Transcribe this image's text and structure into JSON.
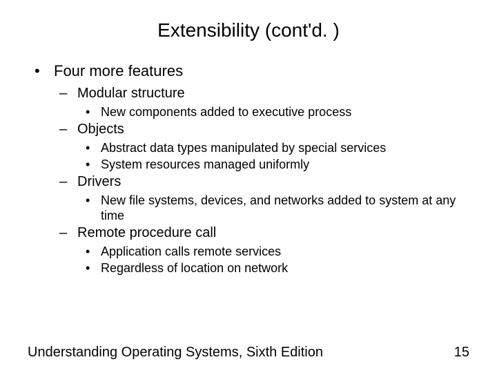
{
  "title": "Extensibility (cont'd. )",
  "l1": "Four more features",
  "items": [
    {
      "label": "Modular structure",
      "subs": [
        "New components added to executive process"
      ]
    },
    {
      "label": "Objects",
      "subs": [
        "Abstract data types manipulated by special services",
        "System resources managed uniformly"
      ]
    },
    {
      "label": "Drivers",
      "subs": [
        "New file systems, devices, and networks added to system at any time"
      ]
    },
    {
      "label": "Remote procedure call",
      "subs": [
        "Application calls remote services",
        "Regardless of location on network"
      ]
    }
  ],
  "footer_left": "Understanding Operating Systems, Sixth Edition",
  "footer_right": "15"
}
